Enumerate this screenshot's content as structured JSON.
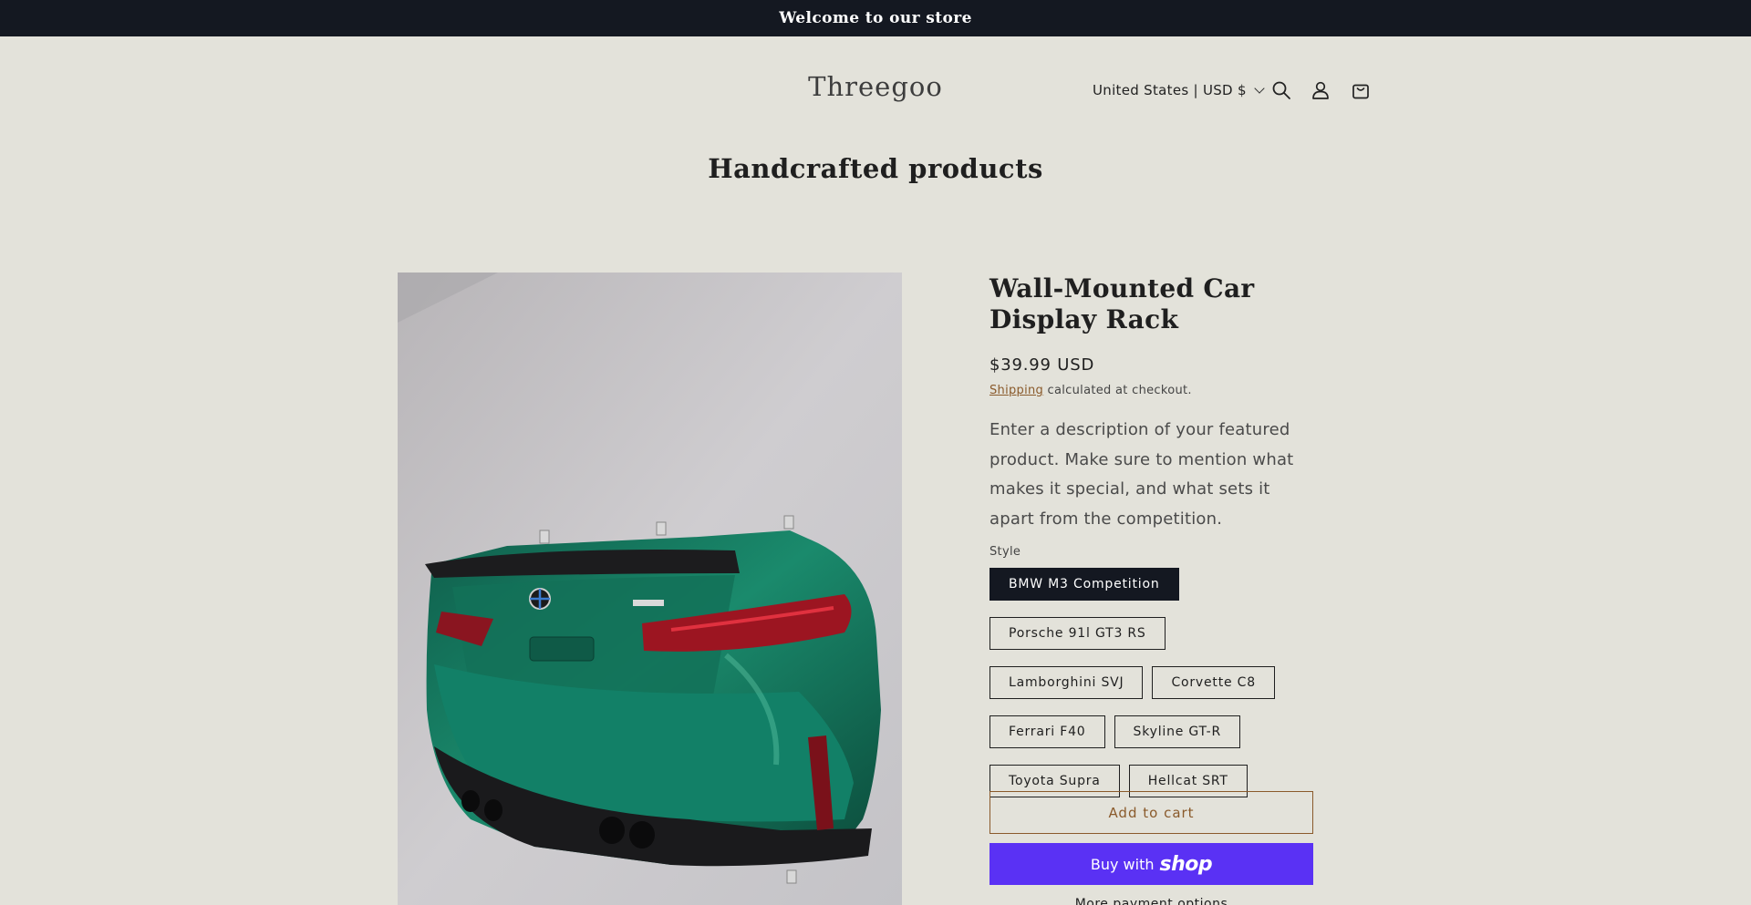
{
  "announcement": {
    "text": "Welcome to our store"
  },
  "header": {
    "logo": "Threegoo",
    "country_selector": "United States | USD $",
    "icons": [
      "search-icon",
      "account-icon",
      "cart-icon"
    ]
  },
  "section": {
    "title": "Handcrafted products"
  },
  "product": {
    "title": "Wall-Mounted Car Display Rack",
    "price": "$39.99 USD",
    "shipping_link": "Shipping",
    "shipping_text": " calculated at checkout.",
    "description": "Enter a description of your featured product. Make sure to mention what makes it special, and what sets it apart from the competition.",
    "style_label": "Style",
    "variants": [
      "BMW M3 Competition",
      "Porsche 91l GT3 RS",
      "Lamborghini SVJ",
      "Corvette C8",
      "Ferrari F40",
      "Skyline GT-R",
      "Toyota Supra",
      "Hellcat SRT"
    ],
    "selected_variant": "BMW M3 Competition",
    "add_to_cart": "Add to cart",
    "buy_with": "Buy with",
    "buy_brand": "shop",
    "more_options": "More payment options"
  },
  "colors": {
    "announcement_bg": "#141821",
    "page_bg": "#e3e2da",
    "accent": "#8a5a2b",
    "shop_pay": "#5a31f4",
    "car_green": "#16705a"
  }
}
